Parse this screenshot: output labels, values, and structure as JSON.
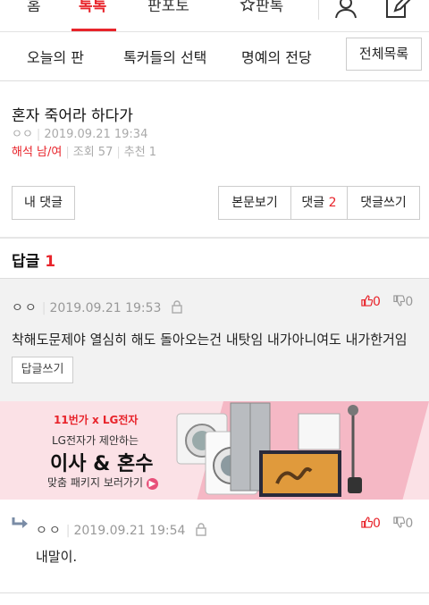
{
  "topnav": {
    "tabs": [
      "홈",
      "톡톡",
      "판포토",
      "판톡"
    ],
    "active_tab": "톡톡"
  },
  "subnav": {
    "items": [
      "오늘의 판",
      "톡커들의 선택",
      "명예의 전당"
    ],
    "all_button": "전체목록"
  },
  "post": {
    "title": "혼자 죽어라 하다가",
    "author_id": "ㅇㅇ",
    "date": "2019.09.21 19:34",
    "author_label": "해석 남/여",
    "views": "조회 57",
    "recommends": "추천 1"
  },
  "actions": {
    "my_comments": "내 댓글",
    "view_body": "본문보기",
    "comments_label": "댓글",
    "comments_count": "2",
    "write_comment": "댓글쓰기"
  },
  "replies": {
    "label": "답글",
    "count": "1"
  },
  "comments": [
    {
      "nick": "ㅇㅇ",
      "date": "2019.09.21 19:53",
      "up": "0",
      "down": "0",
      "text": "착해도문제야 열심히 해도 돌아오는건 내탓임 내가아니여도 내가한거임",
      "reply_button": "답글쓰기"
    },
    {
      "nick": "ㅇㅇ",
      "date": "2019.09.21 19:54",
      "up": "0",
      "down": "0",
      "text": "내말이."
    }
  ],
  "ad": {
    "logo": "11번가 x LG전자",
    "line1": "LG전자가 제안하는",
    "line2": "이사 & 혼수",
    "line3": "맞춤 패키지 보러가기"
  },
  "colors": {
    "accent": "#e8242b",
    "comment_bg": "#f2f2f2",
    "banner_bg": "#fbe1e6"
  }
}
